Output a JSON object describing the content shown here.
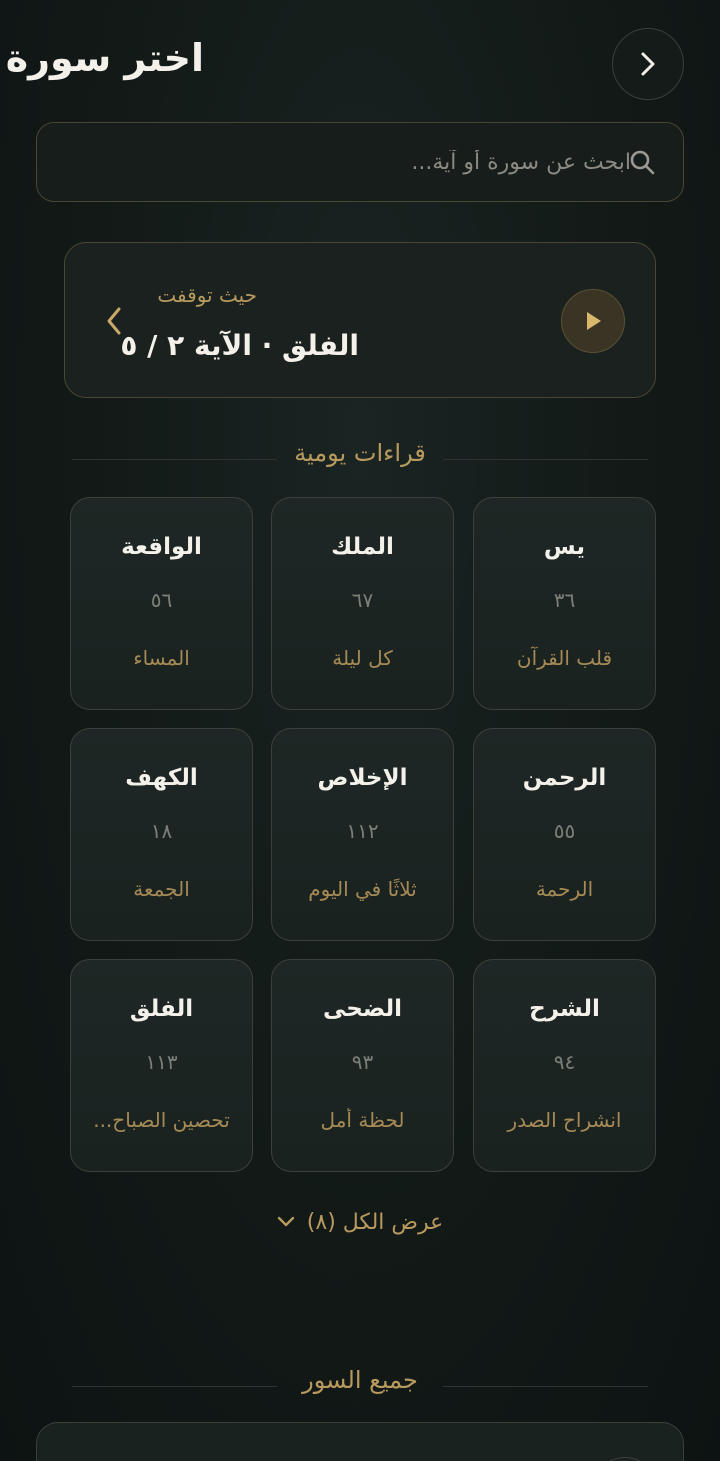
{
  "header": {
    "title": "اختر سورة",
    "back_icon": "chevron-right-icon"
  },
  "search": {
    "placeholder": "ابحث عن سورة أو آية...",
    "value": "",
    "icon": "search-icon"
  },
  "resume": {
    "label": "حيث توقفت",
    "value": "الفلق · الآية ٢ / ٥",
    "play_icon": "play-icon",
    "chevron_icon": "chevron-left-icon"
  },
  "daily_readings": {
    "title": "قراءات يومية",
    "cards": [
      {
        "name": "يس",
        "number": "٣٦",
        "note": "قلب القرآن"
      },
      {
        "name": "الملك",
        "number": "٦٧",
        "note": "كل ليلة"
      },
      {
        "name": "الواقعة",
        "number": "٥٦",
        "note": "المساء"
      },
      {
        "name": "الرحمن",
        "number": "٥٥",
        "note": "الرحمة"
      },
      {
        "name": "الإخلاص",
        "number": "١١٢",
        "note": "ثلاثًا في اليوم"
      },
      {
        "name": "الكهف",
        "number": "١٨",
        "note": "الجمعة"
      },
      {
        "name": "الشرح",
        "number": "٩٤",
        "note": "انشراح الصدر"
      },
      {
        "name": "الضحى",
        "number": "٩٣",
        "note": "لحظة أمل"
      },
      {
        "name": "الفلق",
        "number": "١١٣",
        "note": "تحصين الصباح..."
      }
    ],
    "show_all_label": "عرض الكل (٨)"
  },
  "all_surahs": {
    "title": "جميع السور"
  },
  "colors": {
    "accent_gold": "#b89a5e",
    "background": "#121917",
    "card": "#1e2725"
  }
}
